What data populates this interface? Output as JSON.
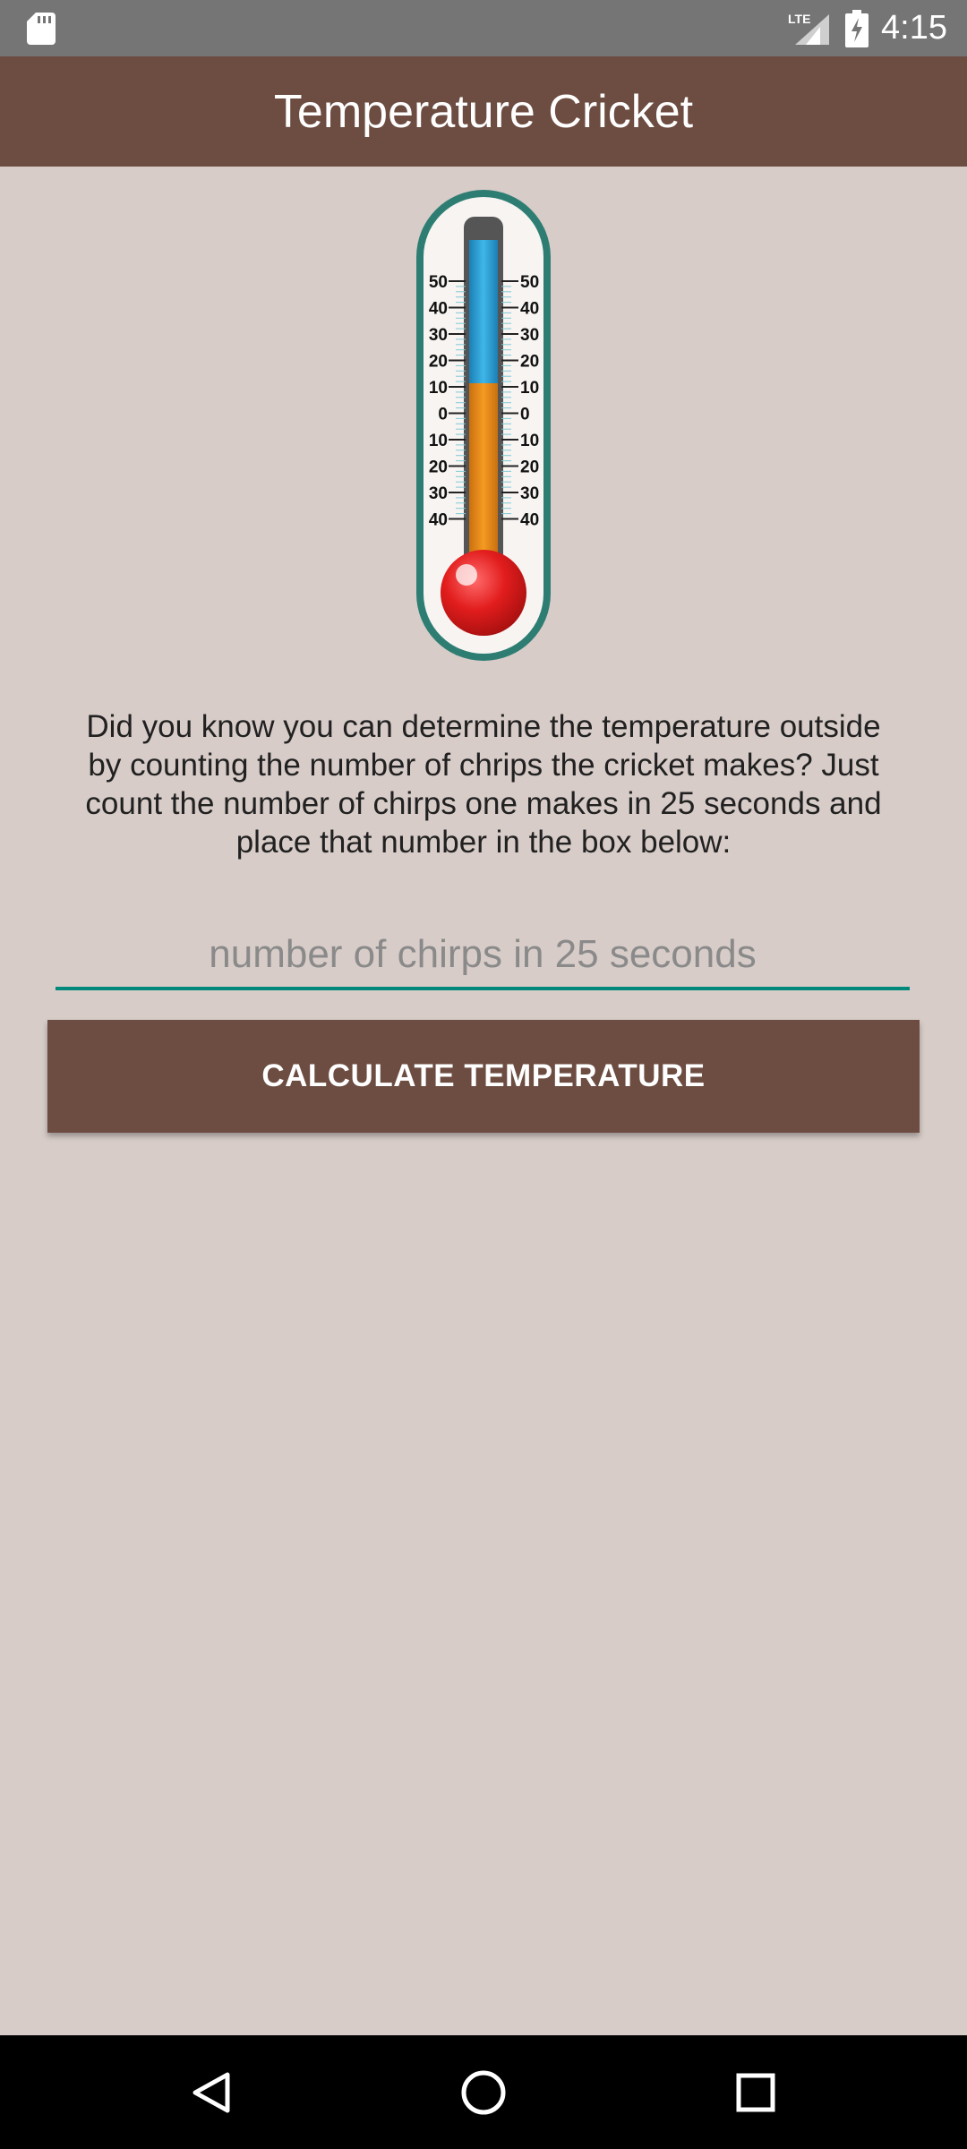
{
  "status_bar": {
    "time": "4:15",
    "network_label": "LTE",
    "icons": [
      "sd-card-icon",
      "lte-signal-icon",
      "battery-charging-icon"
    ]
  },
  "app_bar": {
    "title": "Temperature Cricket"
  },
  "thermometer": {
    "scale_left": [
      "50",
      "40",
      "30",
      "20",
      "10",
      "0",
      "10",
      "20",
      "30",
      "40"
    ],
    "scale_right": [
      "50",
      "40",
      "30",
      "20",
      "10",
      "0",
      "10",
      "20",
      "30",
      "40"
    ]
  },
  "info": {
    "text": "Did you know you can determine the temperature outside by counting the number of chrips the cricket makes? Just count the number of chirps one makes in 25 seconds and place that number in the box below:"
  },
  "chirps_input": {
    "value": "",
    "placeholder": "number of chirps in 25 seconds"
  },
  "calculate_button": {
    "label": "CALCULATE TEMPERATURE"
  },
  "nav_bar": {
    "icons": [
      "back-icon",
      "home-icon",
      "recents-icon"
    ]
  },
  "colors": {
    "app_bar": "#6d4c41",
    "background": "#d7ccc8",
    "status_bar": "#757575",
    "input_underline": "#00897b",
    "button": "#6d4c41"
  }
}
